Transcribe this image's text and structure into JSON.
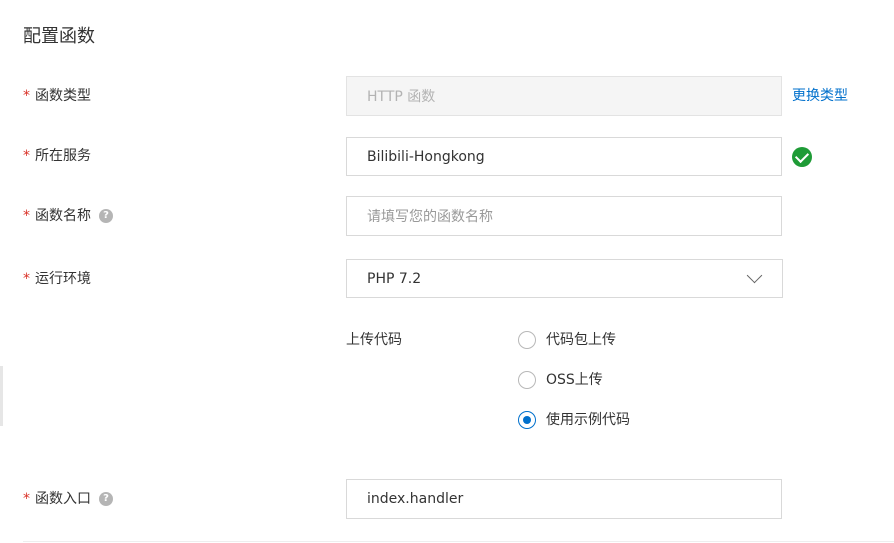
{
  "section_title": "配置函数",
  "required_mark": "*",
  "help_glyph": "?",
  "fields": {
    "function_type": {
      "label": "函数类型",
      "value": "HTTP 函数",
      "change_link": "更换类型"
    },
    "service": {
      "label": "所在服务",
      "value": "Bilibili-Hongkong"
    },
    "function_name": {
      "label": "函数名称",
      "placeholder": "请填写您的函数名称"
    },
    "runtime": {
      "label": "运行环境",
      "value": "PHP 7.2"
    },
    "upload_code": {
      "label": "上传代码",
      "options": [
        {
          "label": "代码包上传",
          "checked": false
        },
        {
          "label": "OSS上传",
          "checked": false
        },
        {
          "label": "使用示例代码",
          "checked": true
        }
      ]
    },
    "handler": {
      "label": "函数入口",
      "value": "index.handler"
    }
  },
  "colors": {
    "link": "#0070cc",
    "success": "#1e9b36",
    "required": "#d93026",
    "radio_checked": "#0070cc"
  }
}
